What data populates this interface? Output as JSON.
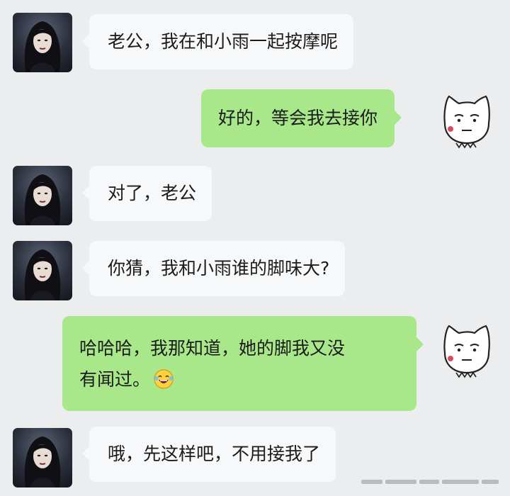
{
  "messages": [
    {
      "side": "in",
      "text": "老公，我在和小雨一起按摩呢"
    },
    {
      "side": "out",
      "text": "好的，等会我去接你"
    },
    {
      "side": "in",
      "text": "对了，老公"
    },
    {
      "side": "in",
      "text": "你猜，我和小雨谁的脚味大?"
    },
    {
      "side": "out",
      "line1": "哈哈哈，我那知道，她的脚我又没",
      "line2": "有闻过。",
      "emoji": "laughing-emoji"
    },
    {
      "side": "in",
      "text": "哦，先这样吧，不用接我了"
    }
  ],
  "avatars": {
    "contact": "woman-portrait-avatar",
    "self": "white-cat-cartoon-avatar"
  },
  "colors": {
    "background": "#ebedef",
    "incoming": "#f7f8f9",
    "outgoing": "#a9e88a"
  }
}
